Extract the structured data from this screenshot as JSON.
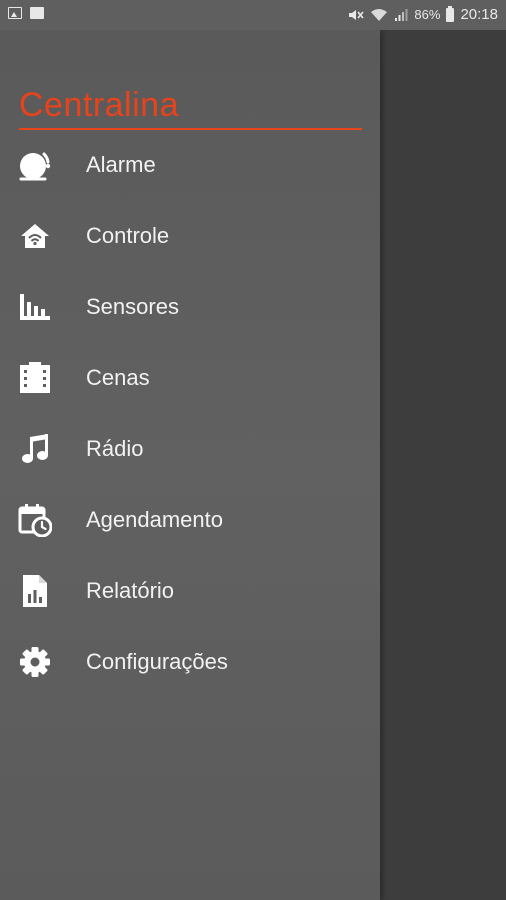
{
  "status_bar": {
    "battery": "86%",
    "time": "20:18"
  },
  "drawer": {
    "title": "Centralina",
    "accent_color": "#e8431a",
    "items": [
      {
        "label": "Alarme",
        "icon": "alarm-bell-icon"
      },
      {
        "label": "Controle",
        "icon": "home-wifi-icon"
      },
      {
        "label": "Sensores",
        "icon": "bar-chart-icon"
      },
      {
        "label": "Cenas",
        "icon": "film-icon"
      },
      {
        "label": "Rádio",
        "icon": "music-note-icon"
      },
      {
        "label": "Agendamento",
        "icon": "calendar-clock-icon"
      },
      {
        "label": "Relatório",
        "icon": "report-document-icon"
      },
      {
        "label": "Configurações",
        "icon": "gear-icon"
      }
    ]
  }
}
